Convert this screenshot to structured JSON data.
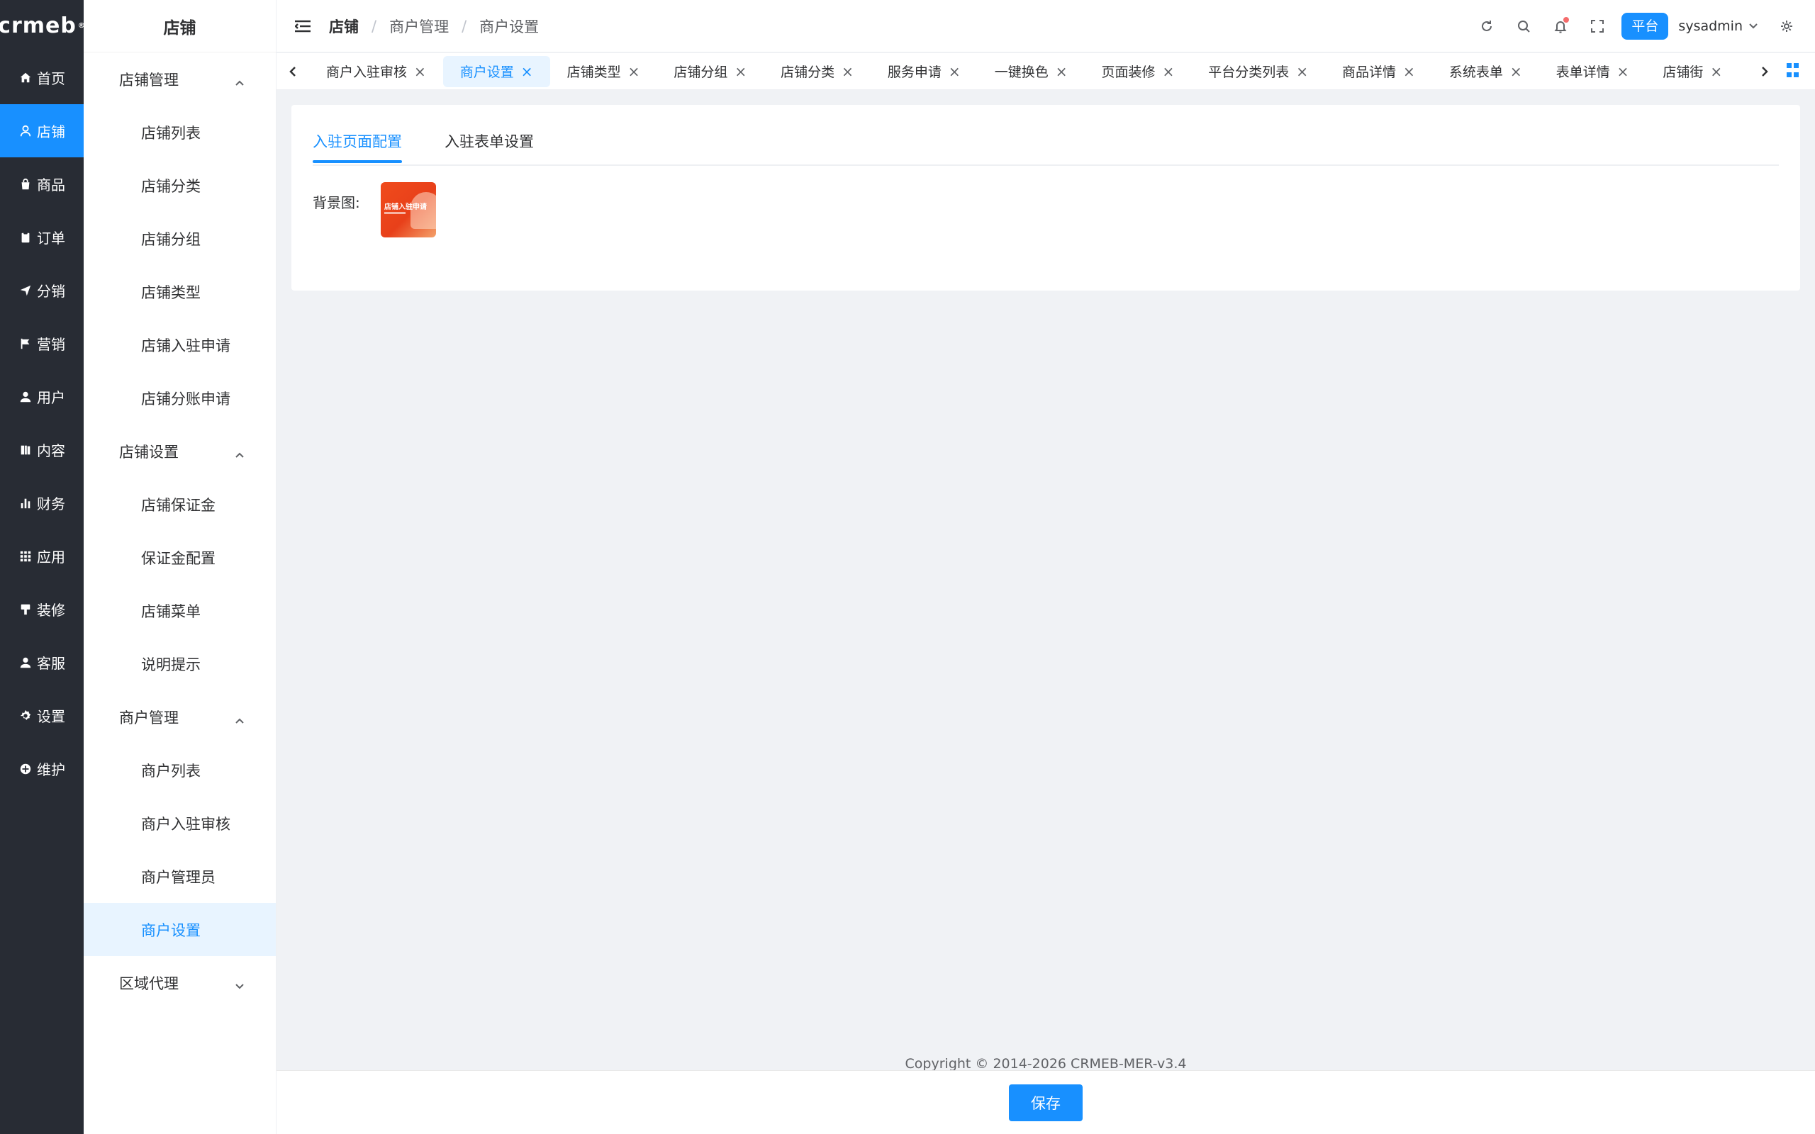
{
  "brand": {
    "logo": "crmeb",
    "trademark": "®"
  },
  "rail": {
    "items": [
      {
        "label": "首页",
        "icon": "home-icon"
      },
      {
        "label": "店铺",
        "icon": "store-icon"
      },
      {
        "label": "商品",
        "icon": "bag-icon"
      },
      {
        "label": "订单",
        "icon": "clipboard-icon"
      },
      {
        "label": "分销",
        "icon": "send-icon"
      },
      {
        "label": "营销",
        "icon": "flag-icon"
      },
      {
        "label": "用户",
        "icon": "user-icon"
      },
      {
        "label": "内容",
        "icon": "book-icon"
      },
      {
        "label": "财务",
        "icon": "bar-chart-icon"
      },
      {
        "label": "应用",
        "icon": "grid-icon"
      },
      {
        "label": "装修",
        "icon": "brush-icon"
      },
      {
        "label": "客服",
        "icon": "headset-icon"
      },
      {
        "label": "设置",
        "icon": "gear-icon"
      },
      {
        "label": "维护",
        "icon": "plus-circle-icon"
      }
    ],
    "active_index": 1
  },
  "submenu": {
    "title": "店铺",
    "groups": [
      {
        "label": "店铺管理",
        "expanded": true,
        "items": [
          "店铺列表",
          "店铺分类",
          "店铺分组",
          "店铺类型",
          "店铺入驻申请",
          "店铺分账申请"
        ]
      },
      {
        "label": "店铺设置",
        "expanded": true,
        "items": [
          "店铺保证金",
          "保证金配置",
          "店铺菜单",
          "说明提示"
        ]
      },
      {
        "label": "商户管理",
        "expanded": true,
        "items": [
          "商户列表",
          "商户入驻审核",
          "商户管理员",
          "商户设置"
        ]
      },
      {
        "label": "区域代理",
        "expanded": false,
        "items": []
      }
    ],
    "active_item": "商户设置"
  },
  "header": {
    "breadcrumb": [
      "店铺",
      "商户管理",
      "商户设置"
    ],
    "separator": "/",
    "platform_label": "平台",
    "username": "sysadmin"
  },
  "tabs": [
    {
      "label": "商户入驻审核",
      "active": false
    },
    {
      "label": "商户设置",
      "active": true
    },
    {
      "label": "店铺类型",
      "active": false
    },
    {
      "label": "店铺分组",
      "active": false
    },
    {
      "label": "店铺分类",
      "active": false
    },
    {
      "label": "服务申请",
      "active": false
    },
    {
      "label": "一键换色",
      "active": false
    },
    {
      "label": "页面装修",
      "active": false
    },
    {
      "label": "平台分类列表",
      "active": false
    },
    {
      "label": "商品详情",
      "active": false
    },
    {
      "label": "系统表单",
      "active": false
    },
    {
      "label": "表单详情",
      "active": false
    },
    {
      "label": "店铺街",
      "active": false
    }
  ],
  "tab_close": "×",
  "content": {
    "inner_tabs": [
      "入驻页面配置",
      "入驻表单设置"
    ],
    "active_inner_tab": 0,
    "background_label": "背景图:",
    "thumb_text": "店铺入驻申请"
  },
  "footer": {
    "copyright": "Copyright © 2014-2026 CRMEB-MER-v3.4",
    "save_label": "保存"
  },
  "colors": {
    "accent": "#1890ff",
    "rail_bg": "#282c34",
    "page_bg": "#f0f2f5"
  }
}
